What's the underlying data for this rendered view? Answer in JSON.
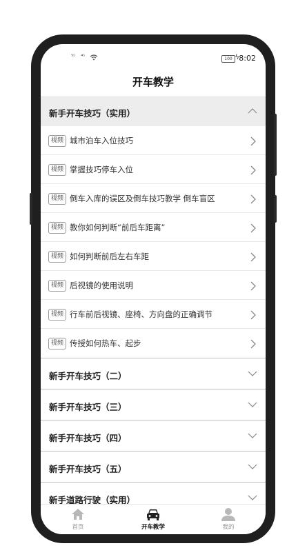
{
  "status_bar": {
    "signal_1": "⁵ᴳ",
    "signal_2": "⁴ᴳ",
    "battery": "100",
    "time": "8:02"
  },
  "header": {
    "title": "开车教学"
  },
  "expanded_section": {
    "title": "新手开车技巧（实用）",
    "tag_label": "视频",
    "items": [
      {
        "label": "城市泊车入位技巧"
      },
      {
        "label": "掌握技巧停车入位"
      },
      {
        "label": "倒车入库的误区及倒车技巧教学 倒车盲区"
      },
      {
        "label": "教你如何判断“前后车距离”"
      },
      {
        "label": "如何判断前后左右车距"
      },
      {
        "label": "后视镜的使用说明"
      },
      {
        "label": "行车前后视镜、座椅、方向盘的正确调节"
      },
      {
        "label": "传授如何热车、起步"
      }
    ]
  },
  "collapsed_sections": [
    {
      "title": "新手开车技巧（二）"
    },
    {
      "title": "新手开车技巧（三）"
    },
    {
      "title": "新手开车技巧（四）"
    },
    {
      "title": "新手开车技巧（五）"
    },
    {
      "title": "新手道路行驶（实用）"
    }
  ],
  "tab_bar": {
    "tabs": [
      {
        "label": "首页",
        "icon": "home-icon"
      },
      {
        "label": "开车教学",
        "icon": "car-icon"
      },
      {
        "label": "我的",
        "icon": "user-icon"
      }
    ]
  },
  "colors": {
    "phone_frame": "#1f1f1f",
    "section_header_bg": "#ededed",
    "active_tab": "#111111",
    "inactive_tab": "#999999"
  }
}
